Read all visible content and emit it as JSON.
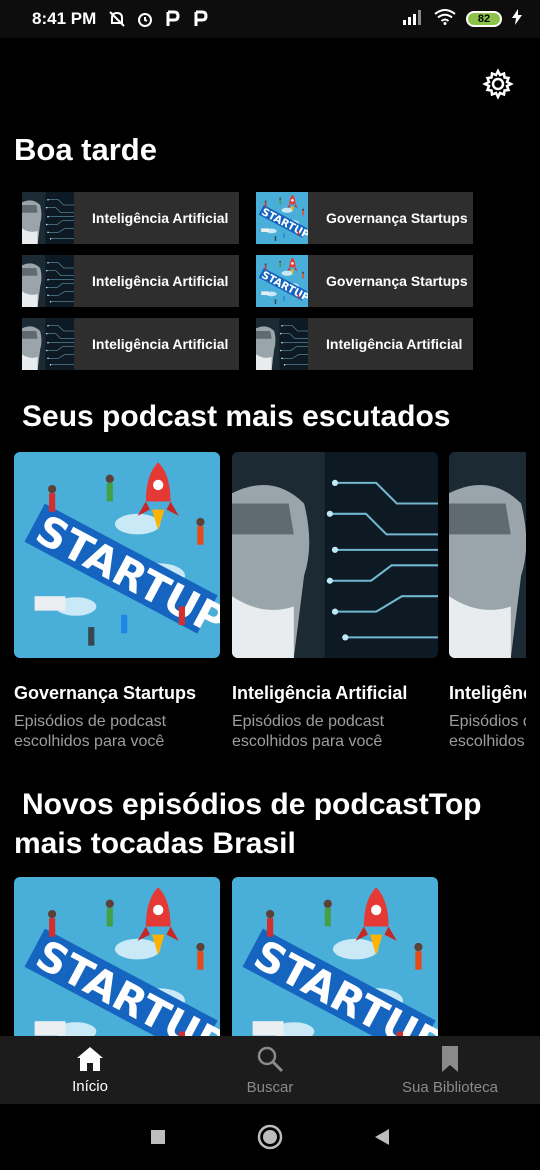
{
  "status_bar": {
    "time": "8:41 PM",
    "battery": "82"
  },
  "greeting": "Boa tarde",
  "quick_items": [
    {
      "label": "Inteligência Artificial",
      "thumb": "ai"
    },
    {
      "label": "Governança Startups",
      "thumb": "startup"
    },
    {
      "label": "Inteligência Artificial",
      "thumb": "ai"
    },
    {
      "label": "Governança Startups",
      "thumb": "startup"
    },
    {
      "label": "Inteligência Artificial",
      "thumb": "ai"
    },
    {
      "label": "Inteligência Artificial",
      "thumb": "ai"
    }
  ],
  "section_most_listened": {
    "title": "Seus podcast mais escutados",
    "cards": [
      {
        "title": "Governança Startups",
        "subtitle": "Episódios de podcast escolhidos para você",
        "thumb": "startup"
      },
      {
        "title": "Inteligência Artificial",
        "subtitle": "Episódios de podcast escolhidos para você",
        "thumb": "ai"
      },
      {
        "title": "Inteligência Artificial",
        "subtitle": "Episódios de podcast escolhidos para você",
        "thumb": "ai"
      }
    ]
  },
  "section_new_episodes": {
    "title_line1": "Novos episódios de podcastTop",
    "title_line2": "mais tocadas Brasil",
    "cards": [
      {
        "thumb": "startup"
      },
      {
        "thumb": "startup"
      }
    ]
  },
  "bottom_nav": [
    {
      "label": "Início",
      "icon": "home-icon",
      "active": true
    },
    {
      "label": "Buscar",
      "icon": "search-icon",
      "active": false
    },
    {
      "label": "Sua Biblioteca",
      "icon": "library-icon",
      "active": false
    }
  ],
  "colors": {
    "background": "#000000",
    "card": "#2e2e2e",
    "nav": "#1c1c1c",
    "muted": "#9e9e9e",
    "startup_bg": "#3fa9d6"
  }
}
